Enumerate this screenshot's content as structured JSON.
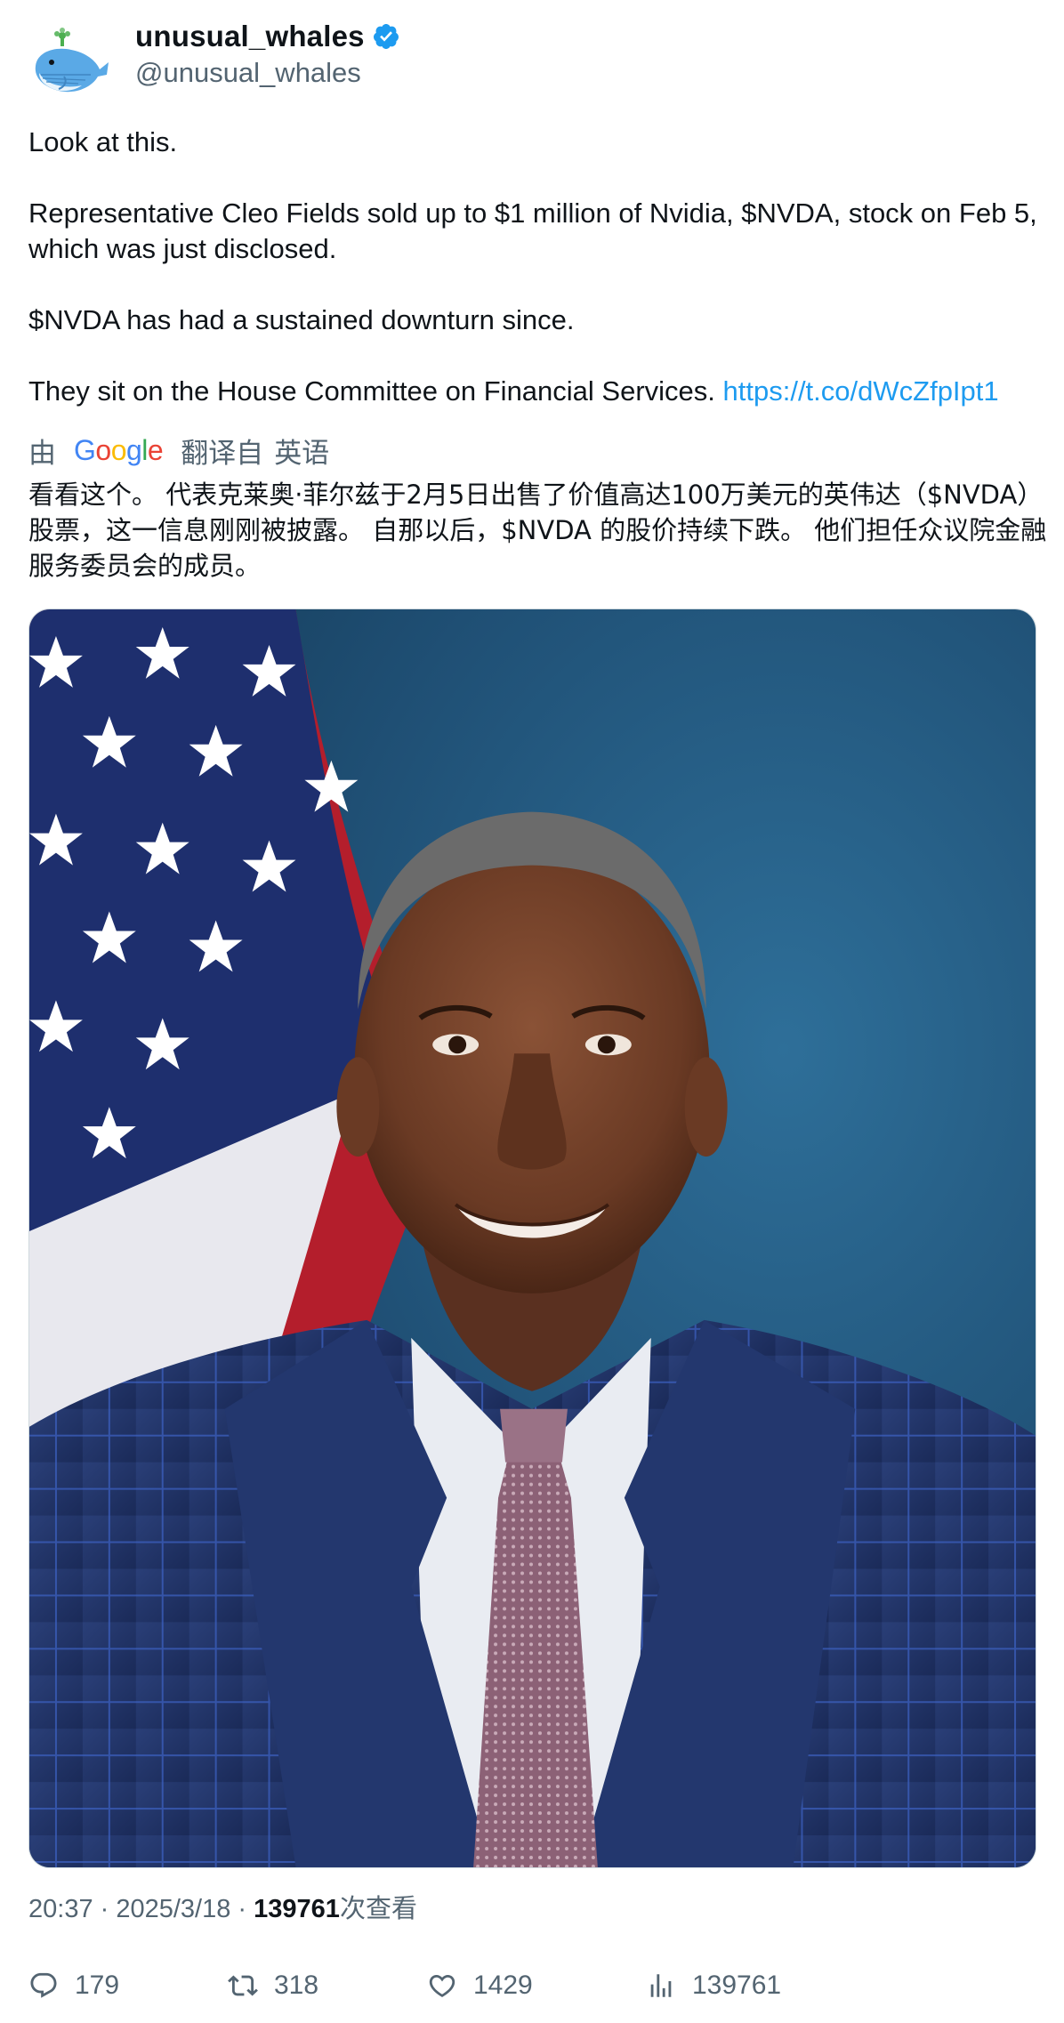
{
  "author": {
    "display_name": "unusual_whales",
    "handle": "@unusual_whales",
    "verified": true,
    "avatar_icon": "whale-avatar-icon",
    "verified_color": "#1d9bf0"
  },
  "tweet": {
    "paragraphs": [
      "Look at this.",
      "Representative Cleo Fields sold up to $1 million of Nvidia, $NVDA, stock on Feb 5, which was just disclosed.",
      "$NVDA has had a sustained downturn since."
    ],
    "last_paragraph_text": "They sit on the House Committee on Financial Services. ",
    "link_text": "https://t.co/dWcZfpIpt1",
    "link_color": "#1d9bf0"
  },
  "translation": {
    "by_label": "由",
    "google_letters": [
      "G",
      "o",
      "o",
      "g",
      "l",
      "e"
    ],
    "from_label": "翻译自",
    "language_label": "英语",
    "translated_text": "看看这个。 代表克莱奥·菲尔兹于2月5日出售了价值高达100万美元的英伟达（$NVDA）股票，这一信息刚刚被披露。 自那以后，$NVDA 的股价持续下跌。 他们担任众议院金融服务委员会的成员。"
  },
  "media": {
    "kind": "portrait-photo",
    "description_icon": "photo-image"
  },
  "meta": {
    "time": "20:37",
    "separator": " · ",
    "date": "2025/3/18",
    "views_number": "139761",
    "views_label": "次查看"
  },
  "actions": {
    "reply_count": "179",
    "retweet_count": "318",
    "like_count": "1429",
    "views_count": "139761",
    "icons": [
      "reply-icon",
      "retweet-icon",
      "like-icon",
      "views-icon"
    ]
  },
  "colors": {
    "text_primary": "#0f1419",
    "text_secondary": "#536471",
    "accent": "#1d9bf0"
  }
}
